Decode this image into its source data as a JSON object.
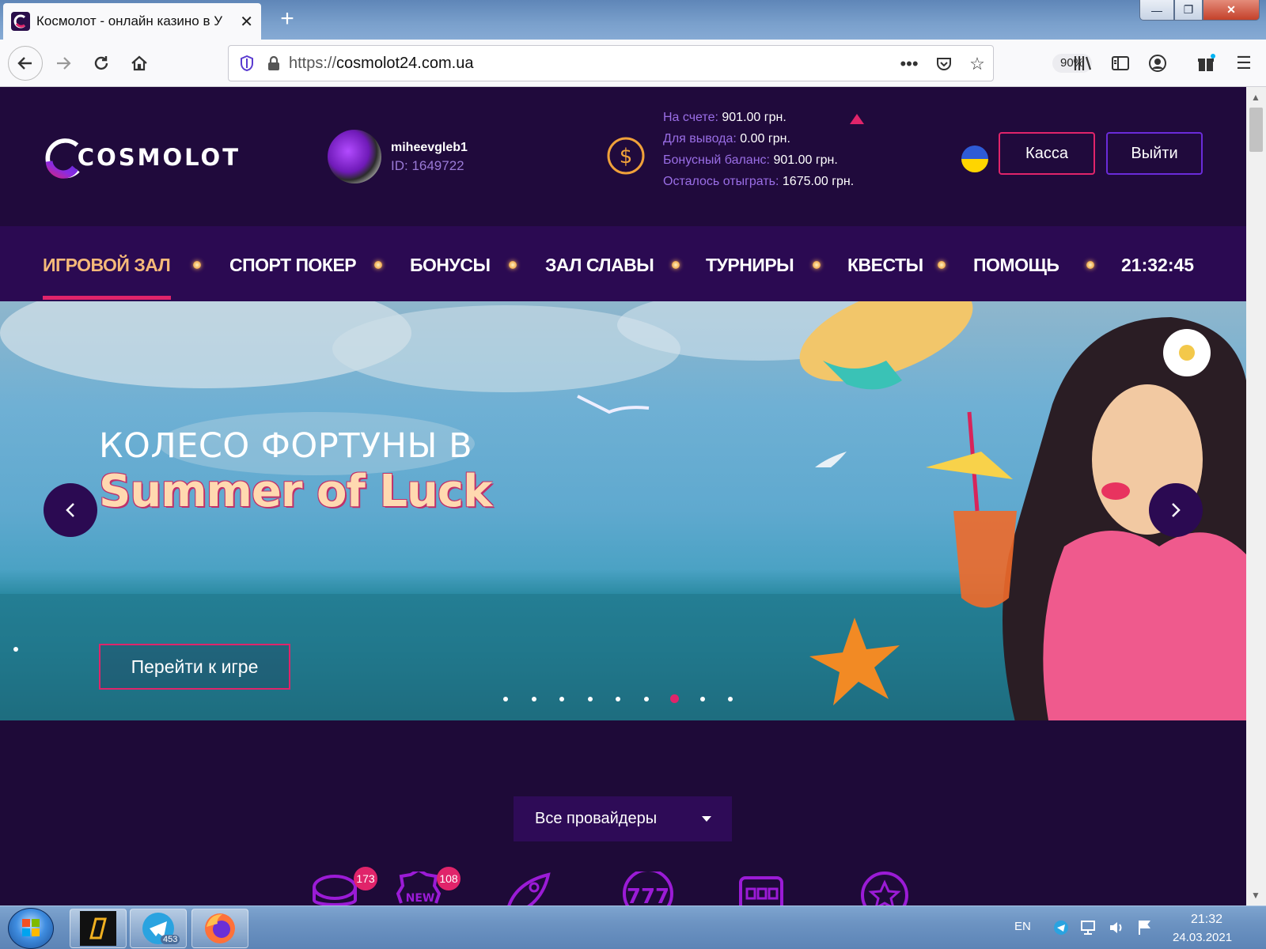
{
  "browser": {
    "tab_title": "Космолот - онлайн казино в У",
    "url_prefix": "https://",
    "url_domain": "cosmolot24.com.ua",
    "zoom": "90%",
    "window_controls": {
      "minimize": "—",
      "maximize": "❐",
      "close": "✕"
    }
  },
  "header": {
    "logo_text": "COSMOLOT",
    "username": "miheevgleb1",
    "user_id": "ID: 1649722",
    "balances": [
      {
        "label": "На счете:",
        "value": "901.00 грн."
      },
      {
        "label": "Для вывода:",
        "value": "0.00 грн."
      },
      {
        "label": "Бонусный баланс:",
        "value": "901.00 грн."
      },
      {
        "label": "Осталось отыграть:",
        "value": "1675.00 грн."
      }
    ],
    "kassa_label": "Касса",
    "logout_label": "Выйти"
  },
  "nav": {
    "items": [
      "ИГРОВОЙ ЗАЛ",
      "СПОРТ ПОКЕР",
      "БОНУСЫ",
      "ЗАЛ СЛАВЫ",
      "ТУРНИРЫ",
      "КВЕСТЫ",
      "ПОМОЩЬ"
    ],
    "active_index": 0,
    "clock": "21:32:45"
  },
  "banner": {
    "title_line1": "КОЛЕСО ФОРТУНЫ В",
    "title_line2": "Summer of Luck",
    "button_label": "Перейти к игре",
    "slide_count": 9,
    "active_slide": 7
  },
  "providers": {
    "label": "Все провайдеры"
  },
  "categories": [
    {
      "icon": "chips-icon",
      "badge": "173"
    },
    {
      "icon": "new-badge-icon",
      "badge": "108"
    },
    {
      "icon": "rocket-icon",
      "badge": ""
    },
    {
      "icon": "sevens-icon",
      "badge": ""
    },
    {
      "icon": "slot-machine-icon",
      "badge": ""
    },
    {
      "icon": "star-icon",
      "badge": ""
    }
  ],
  "taskbar": {
    "telegram_badge": "453",
    "lang": "EN",
    "time": "21:32",
    "date": "24.03.2021"
  },
  "colors": {
    "brand_pink": "#e0246a",
    "brand_purple": "#2b0a52",
    "header_bg": "#200a3c",
    "active_nav": "#f5b979"
  }
}
